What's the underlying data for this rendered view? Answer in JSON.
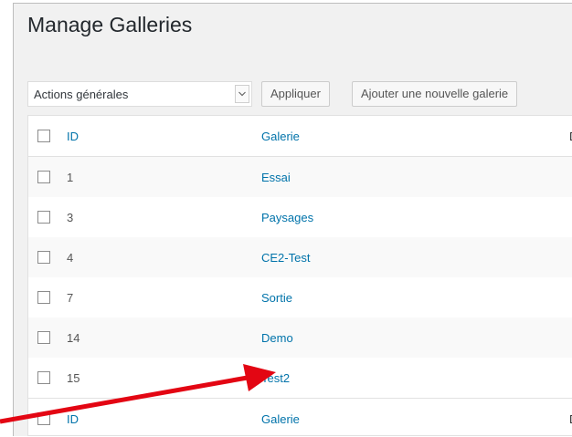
{
  "page": {
    "title": "Manage Galleries"
  },
  "toolbar": {
    "bulk_select": "Actions générales",
    "apply_label": "Appliquer",
    "add_label": "Ajouter une nouvelle galerie"
  },
  "table": {
    "columns": {
      "id": "ID",
      "name": "Galerie",
      "truncated": "D"
    },
    "rows": [
      {
        "id": "1",
        "name": "Essai"
      },
      {
        "id": "3",
        "name": "Paysages"
      },
      {
        "id": "4",
        "name": "CE2-Test"
      },
      {
        "id": "7",
        "name": "Sortie"
      },
      {
        "id": "14",
        "name": "Demo"
      },
      {
        "id": "15",
        "name": "Test2"
      }
    ],
    "footer": {
      "id": "ID",
      "name": "Galerie",
      "truncated": "D"
    }
  },
  "annotation": {
    "arrow_color": "#e30613"
  },
  "colors": {
    "link": "#0073aa",
    "background": "#f1f1f1"
  }
}
